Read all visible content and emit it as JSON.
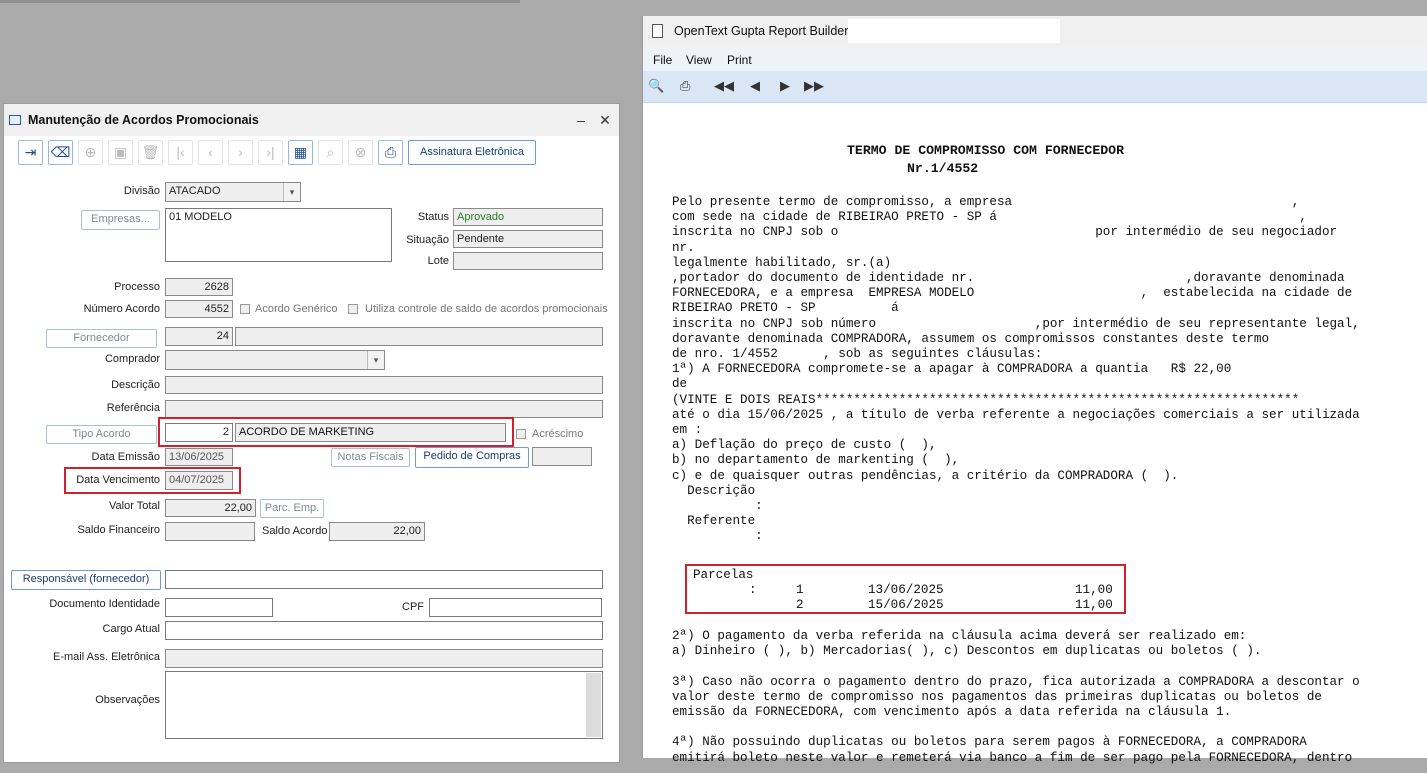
{
  "left_window": {
    "title": "Manutenção de Acordos Promocionais",
    "toolbar": {
      "sign_button": "Assinatura Eletrônica"
    },
    "fields": {
      "divisao_label": "Divisão",
      "divisao_value": "ATACADO",
      "empresas_button": "Empresas...",
      "empresas_value": "01 MODELO",
      "status_label": "Status",
      "status_value": "Aprovado",
      "situacao_label": "Situação",
      "situacao_value": "Pendente",
      "lote_label": "Lote",
      "processo_label": "Processo",
      "processo_value": "2628",
      "numero_label": "Número Acordo",
      "numero_value": "4552",
      "acordo_generico": "Acordo Genérico",
      "utiliza_controle": "Utiliza controle de saldo de acordos promocionais",
      "fornecedor_button": "Fornecedor",
      "fornecedor_value": "24",
      "comprador_label": "Comprador",
      "descricao_label": "Descrição",
      "referencia_label": "Referência",
      "tipo_acordo_button": "Tipo Acordo",
      "tipo_acordo_code": "2",
      "tipo_acordo_desc": "ACORDO DE MARKETING",
      "acrescimo": "Acréscimo",
      "data_emissao_label": "Data Emissão",
      "data_emissao_value": "13/06/2025",
      "notas_fiscais_button": "Notas Fiscais",
      "pedido_compras_button": "Pedido de Compras",
      "data_venc_label": "Data Vencimento",
      "data_venc_value": "04/07/2025",
      "valor_total_label": "Valor Total",
      "valor_total_value": "22,00",
      "parc_emp_button": "Parc. Emp.",
      "saldo_fin_label": "Saldo Financeiro",
      "saldo_acordo_label": "Saldo Acordo",
      "saldo_acordo_value": "22,00",
      "responsavel_button": "Responsável (fornecedor)",
      "doc_ident_label": "Documento Identidade",
      "cpf_label": "CPF",
      "cargo_label": "Cargo Atual",
      "email_label": "E-mail Ass. Eletrônica",
      "obs_label": "Observações"
    }
  },
  "right_window": {
    "title": "OpenText Gupta Report Builder -",
    "menu": [
      "File",
      "View",
      "Print"
    ],
    "toolbar_icons": [
      "preview-icon",
      "printer-icon",
      "first-page-icon",
      "prev-page-icon",
      "next-page-icon",
      "last-page-icon"
    ],
    "document": {
      "title_line1": "TERMO DE COMPROMISSO COM FORNECEDOR",
      "title_line2": "Nr.1/4552",
      "lines": [
        "Pelo presente termo de compromisso, a empresa                                     ,",
        "com sede na cidade de RIBEIRAO PRETO - SP á                                        ,",
        "inscrita no CNPJ sob o                                  por intermédio de seu negociador",
        "nr.",
        "legalmente habilitado, sr.(a)",
        ",portador do documento de identidade nr.                            ,doravante denominada",
        "FORNECEDORA, e a empresa  EMPRESA MODELO                      ,  estabelecida na cidade de",
        "RIBEIRAO PRETO - SP          á",
        "inscrita no CNPJ sob número                     ,por intermédio de seu representante legal,",
        "doravante denominada COMPRADORA, assumem os compromissos constantes deste termo",
        "de nro. 1/4552      , sob as seguintes cláusulas:",
        "1ª) A FORNECEDORA compromete-se a apagar à COMPRADORA a quantia   R$ 22,00",
        "de",
        "(VINTE E DOIS REAIS****************************************************************",
        "até o dia 15/06/2025 , a título de verba referente a negociações comerciais a ser utilizada",
        "em :",
        "a) Deflação do preço de custo (  ),",
        "b) no departamento de markenting (  ),",
        "c) e de quaisquer outras pendências, a critério da COMPRADORA (  ).",
        "  Descrição",
        "           :",
        "  Referente",
        "           :"
      ],
      "parcelas_label": "Parcelas",
      "parcelas": [
        {
          "n": "1",
          "date": "13/06/2025",
          "value": "11,00"
        },
        {
          "n": "2",
          "date": "15/06/2025",
          "value": "11,00"
        }
      ],
      "parcelas_colon": ":",
      "clauses": [
        "2ª) O pagamento da verba referida na cláusula acima deverá ser realizado em:",
        "a) Dinheiro ( ), b) Mercadorias( ), c) Descontos em duplicatas ou boletos ( ).",
        "",
        "3ª) Caso não ocorra o pagamento dentro do prazo, fica autorizada a COMPRADORA a descontar o",
        "valor deste termo de compromisso nos pagamentos das primeiras duplicatas ou boletos de",
        "emissão da FORNECEDORA, com vencimento após a data referida na cláusula 1.",
        "",
        "4ª) Não possuindo duplicatas ou boletos para serem pagos à FORNECEDORA, a COMPRADORA",
        "emitirá boleto neste valor e remeterá via banco a fim de ser pago pela FORNECEDORA, dentro"
      ]
    }
  },
  "colors": {
    "highlight": "#d4202a",
    "accent": "#1e4f8c",
    "status_green": "#2a7a2a"
  }
}
